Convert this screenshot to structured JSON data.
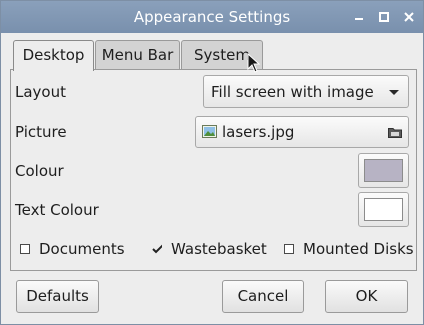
{
  "window": {
    "title": "Appearance Settings"
  },
  "tabs": [
    {
      "label": "Desktop",
      "active": true
    },
    {
      "label": "Menu Bar",
      "active": false
    },
    {
      "label": "System",
      "active": false
    }
  ],
  "desktop": {
    "layout": {
      "label": "Layout",
      "value": "Fill screen with image"
    },
    "picture": {
      "label": "Picture",
      "value": "lasers.jpg"
    },
    "colour": {
      "label": "Colour",
      "value": "#b7b3c4"
    },
    "text_colour": {
      "label": "Text Colour",
      "value": "#ffffff"
    },
    "checks": [
      {
        "label": "Documents",
        "checked": false
      },
      {
        "label": "Wastebasket",
        "checked": true
      },
      {
        "label": "Mounted Disks",
        "checked": false
      }
    ]
  },
  "buttons": {
    "defaults": "Defaults",
    "cancel": "Cancel",
    "ok": "OK"
  },
  "colors": {
    "titlebar": "#8298b5",
    "window_bg": "#ededed"
  }
}
